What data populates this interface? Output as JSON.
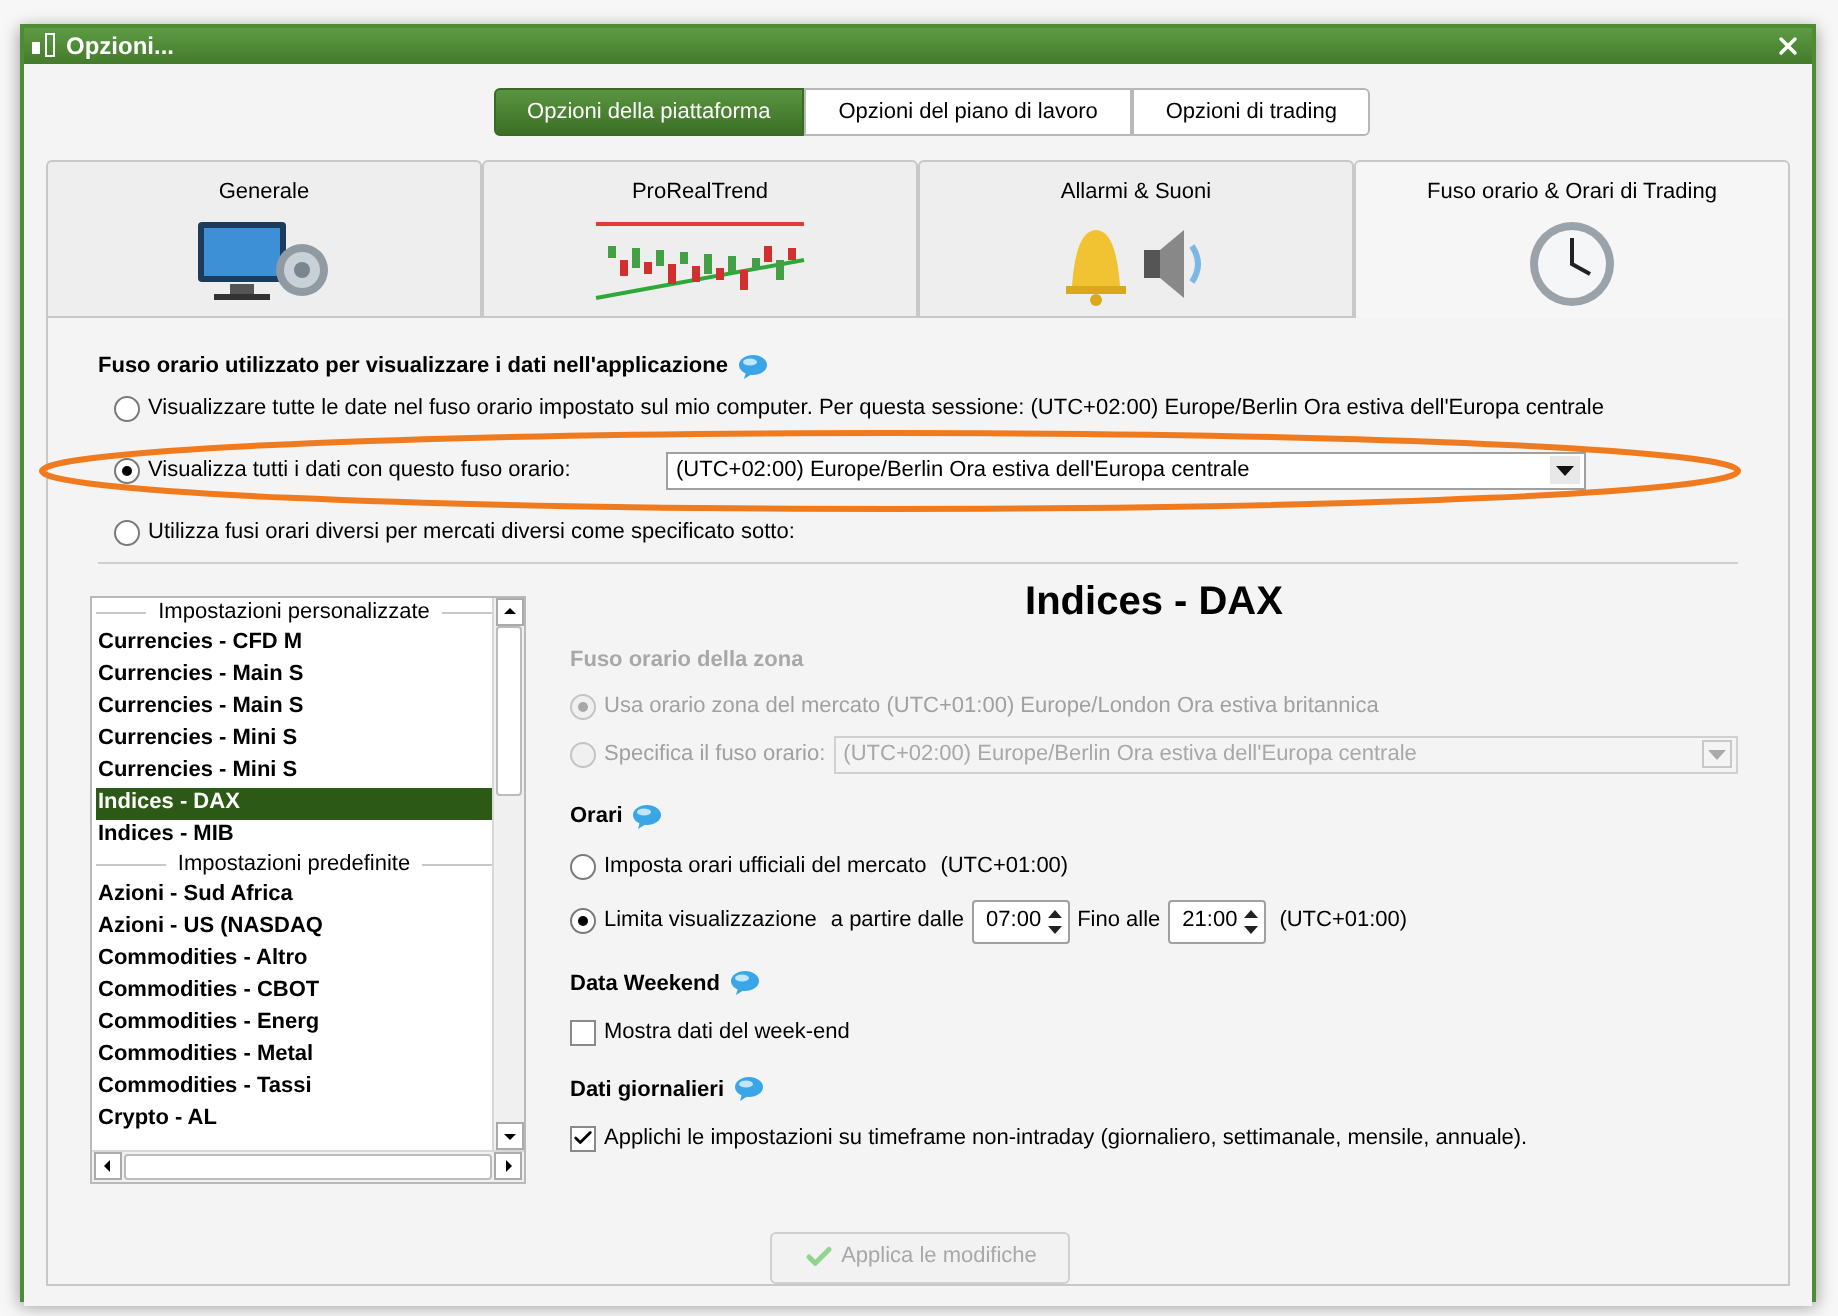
{
  "window": {
    "title": "Opzioni..."
  },
  "platform_tabs": [
    {
      "label": "Opzioni della piattaforma",
      "selected": true
    },
    {
      "label": "Opzioni del piano di lavoro",
      "selected": false
    },
    {
      "label": "Opzioni di trading",
      "selected": false
    }
  ],
  "category_tabs": [
    {
      "label": "Generale",
      "selected": false,
      "kind": "monitor"
    },
    {
      "label": "ProRealTrend",
      "selected": false,
      "kind": "chart"
    },
    {
      "label": "Allarmi & Suoni",
      "selected": false,
      "kind": "sound"
    },
    {
      "label": "Fuso orario & Orari di Trading",
      "selected": true,
      "kind": "clock"
    }
  ],
  "timezone": {
    "heading": "Fuso orario utilizzato per visualizzare i dati nell'applicazione",
    "options": [
      {
        "label": "Visualizzare tutte le date nel fuso orario impostato sul mio computer. Per questa sessione: (UTC+02:00) Europe/Berlin Ora estiva dell'Europa centrale",
        "selected": false,
        "kind": "text"
      },
      {
        "label": "Visualizza tutti i dati con questo fuso orario:",
        "selected": true,
        "kind": "select",
        "value": "(UTC+02:00) Europe/Berlin Ora estiva dell'Europa centrale"
      },
      {
        "label": "Utilizza fusi orari diversi per mercati diversi come specificato sotto:",
        "selected": false,
        "kind": "text"
      }
    ]
  },
  "markets": [
    {
      "header": "Impostazioni personalizzate",
      "items": [
        {
          "label": "Currencies - CFD M",
          "selected": false
        },
        {
          "label": "Currencies - Main S",
          "selected": false
        },
        {
          "label": "Currencies - Main S",
          "selected": false
        },
        {
          "label": "Currencies - Mini S",
          "selected": false
        },
        {
          "label": "Currencies - Mini S",
          "selected": false
        },
        {
          "label": "Indices - DAX",
          "selected": true
        },
        {
          "label": "Indices - MIB",
          "selected": false
        }
      ]
    },
    {
      "header": "Impostazioni predefinite",
      "items": [
        {
          "label": "Azioni - Sud Africa",
          "selected": false
        },
        {
          "label": "Azioni - US (NASDAQ",
          "selected": false
        },
        {
          "label": "Commodities - Altro",
          "selected": false
        },
        {
          "label": "Commodities - CBOT",
          "selected": false
        },
        {
          "label": "Commodities - Energ",
          "selected": false
        },
        {
          "label": "Commodities - Metal",
          "selected": false
        },
        {
          "label": "Commodities - Tassi",
          "selected": false
        },
        {
          "label": "Crypto - AL",
          "selected": false
        }
      ]
    }
  ],
  "detail": {
    "title": "Indices - DAX",
    "zone": {
      "heading": "Fuso orario della zona",
      "disabled": true,
      "options": [
        {
          "label": "Usa orario zona del mercato (UTC+01:00) Europe/London Ora estiva britannica",
          "selected": true,
          "kind": "text"
        },
        {
          "label": "Specifica il fuso orario:",
          "selected": false,
          "kind": "select",
          "value": "(UTC+02:00) Europe/Berlin Ora estiva dell'Europa centrale"
        }
      ]
    },
    "hours": {
      "heading": "Orari",
      "options": [
        {
          "label": "Imposta orari ufficiali del mercato",
          "selected": false,
          "kind": "text",
          "suffix": "(UTC+01:00)"
        },
        {
          "label": "Limita visualizzazione",
          "selected": true,
          "kind": "range",
          "from_label": "a partire dalle",
          "from": "07:00",
          "to_label": "Fino alle",
          "to": "21:00",
          "suffix": "(UTC+01:00)"
        }
      ]
    },
    "weekend": {
      "heading": "Data Weekend",
      "label": "Mostra dati del week-end",
      "checked": false
    },
    "daily": {
      "heading": "Dati giornalieri",
      "label": "Applichi le impostazioni su timeframe non-intraday (giornaliero, settimanale, mensile, annuale).",
      "checked": true
    },
    "apply": {
      "label": "Applica le modifiche",
      "disabled": true
    }
  }
}
